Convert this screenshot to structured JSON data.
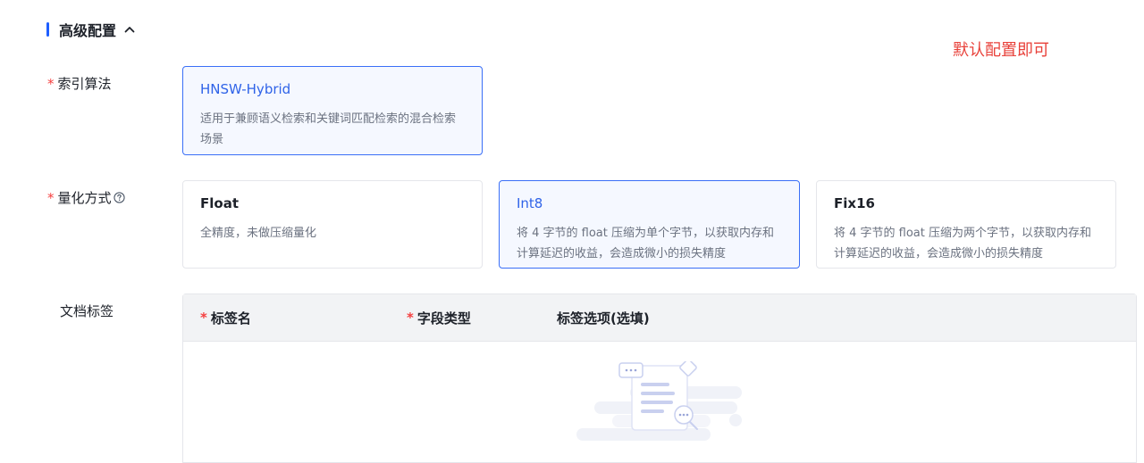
{
  "section": {
    "title": "高级配置"
  },
  "note": "默认配置即可",
  "index_algorithm": {
    "label": "索引算法",
    "options": [
      {
        "title": "HNSW-Hybrid",
        "desc": "适用于兼顾语义检索和关键词匹配检索的混合检索场景",
        "selected": true
      }
    ]
  },
  "quantization": {
    "label": "量化方式",
    "options": [
      {
        "title": "Float",
        "desc": "全精度，未做压缩量化",
        "selected": false
      },
      {
        "title": "Int8",
        "desc": "将 4 字节的 float 压缩为单个字节，以获取内存和计算延迟的收益，会造成微小的损失精度",
        "selected": true
      },
      {
        "title": "Fix16",
        "desc": "将 4 字节的 float 压缩为两个字节，以获取内存和计算延迟的收益，会造成微小的损失精度",
        "selected": false
      }
    ]
  },
  "doc_tags": {
    "label": "文档标签",
    "columns": [
      "标签名",
      "字段类型",
      "标签选项(选填)"
    ]
  },
  "icons": {
    "collapse": "chevron-up-icon",
    "help": "question-circle-icon"
  },
  "colors": {
    "accent": "#1e5eff",
    "selected_border": "#3a6ff7",
    "required": "#f53f3f",
    "note": "#e8413a"
  }
}
